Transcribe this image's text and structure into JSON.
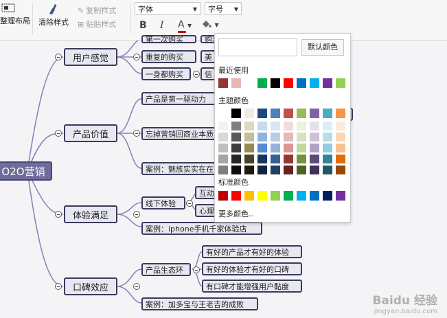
{
  "toolbar": {
    "layout_label": "整理布局",
    "clear_style_label": "清除样式",
    "copy_style_label": "复制样式",
    "paste_style_label": "粘贴样式",
    "font_value": "字体",
    "size_value": "字号",
    "bold_label": "B",
    "italic_label": "I",
    "font_color_label": "A",
    "font_color": "#c00000"
  },
  "mindmap": {
    "root": "O2O营销",
    "branches": [
      {
        "label": "用户感觉",
        "children": [
          "第一次购买",
          "重复的购买",
          "一身都购买"
        ],
        "sub": [
          "购买",
          "美",
          "信"
        ]
      },
      {
        "label": "产品价值",
        "children": [
          "产品是第一驱动力",
          "忘掉营销回商业本质",
          "案例：魅族实实在在"
        ]
      },
      {
        "label": "体验满足",
        "children": [
          "线下体验",
          "案例：iphone手机千家体验店"
        ],
        "sub": [
          "互动",
          "心理"
        ]
      },
      {
        "label": "口碑效应",
        "children": [
          "产品生态环",
          "案例：加多宝与王老吉的成败"
        ],
        "sub": [
          "有好的产品才有好的体验",
          "有好的体验才有好的口碑",
          "有口碑才能增强用户黏度"
        ]
      }
    ]
  },
  "color_panel": {
    "default_button": "默认颜色",
    "recent_title": "最近使用",
    "theme_title": "主题颜色",
    "standard_title": "标准颜色",
    "more_colors": "更多颜色..",
    "recent_colors": [
      "#953735",
      "#e6b9b8",
      "#ffffff",
      "#00b050",
      "#000000",
      "#ff0000",
      "#0070c0",
      "#00b0f0",
      "#7030a0",
      "#92d050"
    ],
    "theme_colors": [
      [
        "#ffffff",
        "#000000",
        "#eeece1",
        "#1f497d",
        "#4f81bd",
        "#c0504d",
        "#9bbb59",
        "#8064a2",
        "#4bacc6",
        "#f79646"
      ],
      [
        "#f2f2f2",
        "#7f7f7f",
        "#ddd9c3",
        "#c6d9f0",
        "#dbe5f1",
        "#f2dcdb",
        "#ebf1dd",
        "#e5e0ec",
        "#dbeef3",
        "#fdeada"
      ],
      [
        "#d8d8d8",
        "#595959",
        "#c4bd97",
        "#8db3e2",
        "#b8cce4",
        "#e5b9b7",
        "#d7e3bc",
        "#ccc1d9",
        "#b7dde8",
        "#fbd5b5"
      ],
      [
        "#bfbfbf",
        "#3f3f3f",
        "#938953",
        "#548dd4",
        "#95b3d7",
        "#d99694",
        "#c3d69b",
        "#b2a2c7",
        "#92cddc",
        "#fac08f"
      ],
      [
        "#a5a5a5",
        "#262626",
        "#494429",
        "#17365d",
        "#366092",
        "#953734",
        "#76923c",
        "#5f497a",
        "#31859b",
        "#e36c09"
      ],
      [
        "#7f7f7f",
        "#0c0c0c",
        "#1d1b10",
        "#0f243e",
        "#244061",
        "#632423",
        "#4f6128",
        "#3f3151",
        "#205867",
        "#974806"
      ]
    ],
    "standard_colors": [
      "#c00000",
      "#ff0000",
      "#ffc000",
      "#ffff00",
      "#92d050",
      "#00b050",
      "#00b0f0",
      "#0070c0",
      "#002060",
      "#7030a0"
    ]
  },
  "watermark": {
    "line1": "Baidu 经验",
    "line2": "jingyan.baidu.com"
  }
}
